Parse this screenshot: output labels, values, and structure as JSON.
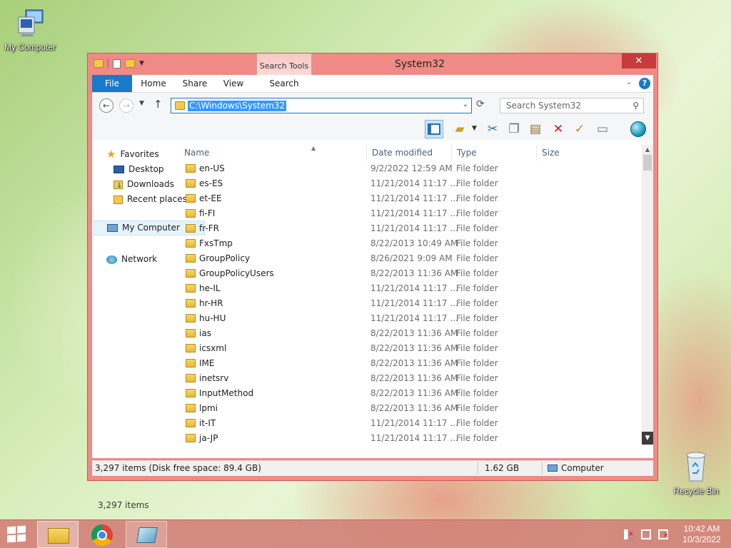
{
  "desktop": {
    "icons": [
      {
        "label": "My Computer"
      },
      {
        "label": "Recycle Bin"
      }
    ]
  },
  "window": {
    "title": "System32",
    "context_tab_group": "Search Tools",
    "controls": {
      "minimize": "–",
      "close": "✕"
    },
    "ribbon_tabs": [
      "File",
      "Home",
      "Share",
      "View",
      "Search"
    ],
    "address": {
      "path": "C:\\Windows\\System32"
    },
    "search": {
      "placeholder": "Search System32"
    },
    "navigation": {
      "favorites": "Favorites",
      "favorites_items": [
        "Desktop",
        "Downloads",
        "Recent places"
      ],
      "computer": "My Computer",
      "network": "Network"
    },
    "columns": [
      "Name",
      "Date modified",
      "Type",
      "Size"
    ],
    "files": [
      {
        "name": "en-US",
        "date": "9/2/2022 12:59 AM",
        "type": "File folder"
      },
      {
        "name": "es-ES",
        "date": "11/21/2014 11:17 ...",
        "type": "File folder"
      },
      {
        "name": "et-EE",
        "date": "11/21/2014 11:17 ...",
        "type": "File folder"
      },
      {
        "name": "fi-FI",
        "date": "11/21/2014 11:17 ...",
        "type": "File folder"
      },
      {
        "name": "fr-FR",
        "date": "11/21/2014 11:17 ...",
        "type": "File folder"
      },
      {
        "name": "FxsTmp",
        "date": "8/22/2013 10:49 AM",
        "type": "File folder"
      },
      {
        "name": "GroupPolicy",
        "date": "8/26/2021 9:09 AM",
        "type": "File folder"
      },
      {
        "name": "GroupPolicyUsers",
        "date": "8/22/2013 11:36 AM",
        "type": "File folder"
      },
      {
        "name": "he-IL",
        "date": "11/21/2014 11:17 ...",
        "type": "File folder"
      },
      {
        "name": "hr-HR",
        "date": "11/21/2014 11:17 ...",
        "type": "File folder"
      },
      {
        "name": "hu-HU",
        "date": "11/21/2014 11:17 ...",
        "type": "File folder"
      },
      {
        "name": "ias",
        "date": "8/22/2013 11:36 AM",
        "type": "File folder"
      },
      {
        "name": "icsxml",
        "date": "8/22/2013 11:36 AM",
        "type": "File folder"
      },
      {
        "name": "IME",
        "date": "8/22/2013 11:36 AM",
        "type": "File folder"
      },
      {
        "name": "inetsrv",
        "date": "8/22/2013 11:36 AM",
        "type": "File folder"
      },
      {
        "name": "InputMethod",
        "date": "8/22/2013 11:36 AM",
        "type": "File folder"
      },
      {
        "name": "lpmi",
        "date": "8/22/2013 11:36 AM",
        "type": "File folder"
      },
      {
        "name": "it-IT",
        "date": "11/21/2014 11:17 ...",
        "type": "File folder"
      },
      {
        "name": "ja-JP",
        "date": "11/21/2014 11:17 ...",
        "type": "File folder"
      }
    ],
    "items_count": "3,297 items",
    "status": {
      "summary": "3,297 items (Disk free space: 89.4 GB)",
      "size": "1.62 GB",
      "location": "Computer"
    }
  },
  "taskbar": {
    "clock": {
      "time": "10:42 AM",
      "date": "10/3/2022"
    }
  },
  "colors": {
    "window_frame": "#f08a86",
    "file_tab": "#1979ca",
    "close_button": "#c73b3b",
    "selection": "#3399ff"
  }
}
